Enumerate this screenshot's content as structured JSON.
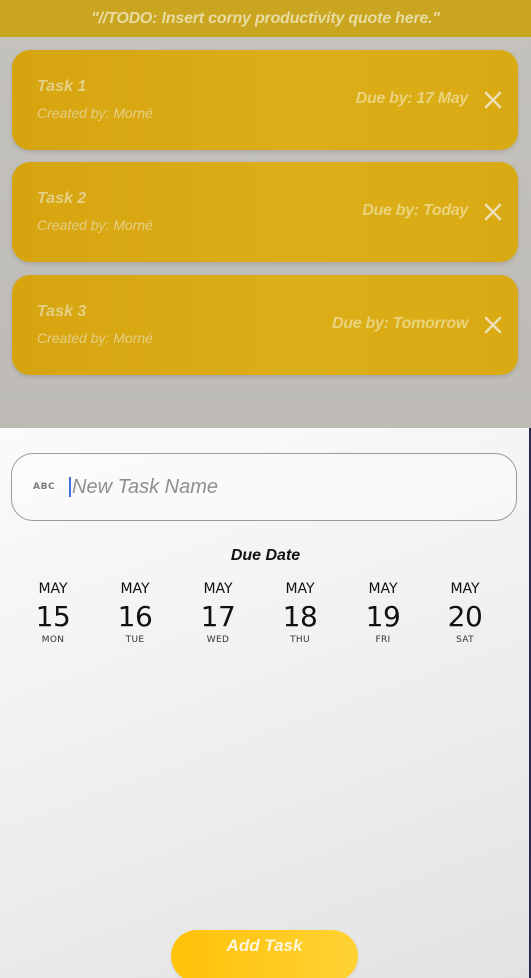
{
  "header": {
    "quote": "\"//TODO: Insert corny productivity quote here.\""
  },
  "tasks": [
    {
      "name": "Task 1",
      "created_by": "Created by: Morné",
      "due": "Due by: 17 May"
    },
    {
      "name": "Task 2",
      "created_by": "Created by: Morné",
      "due": "Due by: Today"
    },
    {
      "name": "Task 3",
      "created_by": "Created by: Morné",
      "due": "Due by: Tomorrow"
    }
  ],
  "sheet": {
    "input_icon": "ABC",
    "input_placeholder": "New Task Name",
    "due_heading": "Due Date",
    "dates": [
      {
        "month": "MAY",
        "day": "15",
        "weekday": "MON"
      },
      {
        "month": "MAY",
        "day": "16",
        "weekday": "TUE"
      },
      {
        "month": "MAY",
        "day": "17",
        "weekday": "WED"
      },
      {
        "month": "MAY",
        "day": "18",
        "weekday": "THU"
      },
      {
        "month": "MAY",
        "day": "19",
        "weekday": "FRI"
      },
      {
        "month": "MAY",
        "day": "20",
        "weekday": "SAT"
      }
    ],
    "add_button": "Add Task"
  },
  "icons": {
    "delete": "close-icon",
    "text_input": "abc-icon"
  },
  "colors": {
    "accent": "#ffc108",
    "card": "#d6a40f",
    "cursor": "#3d6fd8"
  }
}
